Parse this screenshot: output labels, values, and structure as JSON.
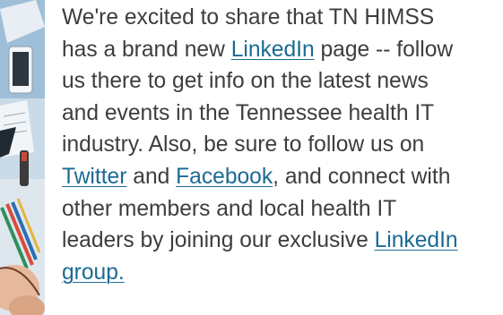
{
  "article": {
    "lines": [
      {
        "parts": [
          {
            "text": "We're excited to share that TN HIMSS",
            "link": false
          }
        ]
      },
      {
        "parts": [
          {
            "text": "has a brand new ",
            "link": false
          },
          {
            "text": "LinkedIn",
            "link": true
          },
          {
            "text": " page -- follow",
            "link": false
          }
        ]
      },
      {
        "parts": [
          {
            "text": "us there to get info on the latest news",
            "link": false
          }
        ]
      },
      {
        "parts": [
          {
            "text": "and events in the Tennessee health IT",
            "link": false
          }
        ]
      },
      {
        "parts": [
          {
            "text": "industry. Also, be sure to follow us on",
            "link": false
          }
        ]
      },
      {
        "parts": [
          {
            "text": "Twitter",
            "link": true
          },
          {
            "text": " and ",
            "link": false
          },
          {
            "text": "Facebook",
            "link": true
          },
          {
            "text": ", and connect with",
            "link": false
          }
        ]
      },
      {
        "parts": [
          {
            "text": "other members and local health IT",
            "link": false
          }
        ]
      },
      {
        "parts": [
          {
            "text": "leaders by joining our exclusive ",
            "link": false
          },
          {
            "text": "LinkedIn",
            "link": true
          }
        ]
      },
      {
        "parts": [
          {
            "text": "group.",
            "link": true
          }
        ]
      }
    ]
  },
  "colors": {
    "body_text": "#3d3d3d",
    "link": "#1b6a93",
    "background": "#ffffff"
  },
  "photo": {
    "icon": "desk-workspace-photo"
  }
}
